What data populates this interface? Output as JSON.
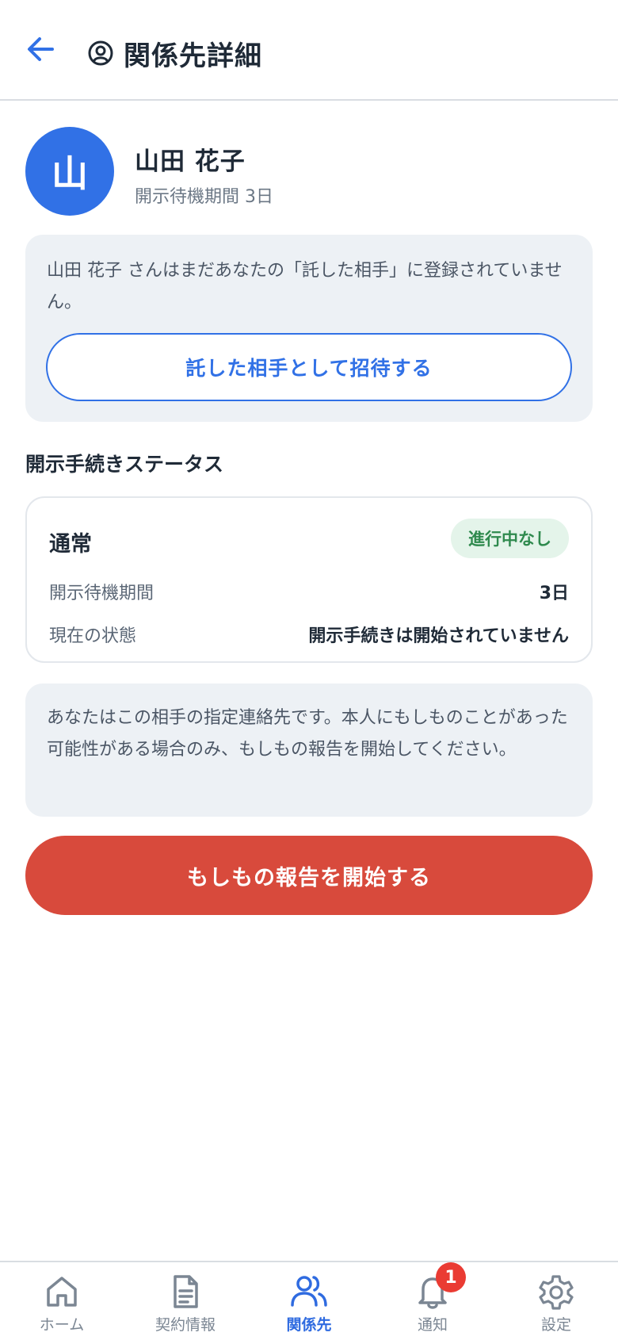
{
  "header": {
    "title": "関係先詳細"
  },
  "profile": {
    "avatar_initial": "山",
    "name": "山田 花子",
    "subtitle": "開示待機期間 3日"
  },
  "invite": {
    "message": "山田 花子 さんはまだあなたの「託した相手」に登録されていません。",
    "button_label": "託した相手として招待する"
  },
  "status_section": {
    "title": "開示手続きステータス",
    "card": {
      "name": "通常",
      "badge": "進行中なし",
      "rows": [
        {
          "label": "開示待機期間",
          "value": "3日"
        },
        {
          "label": "現在の状態",
          "value": "開示手続きは開始されていません"
        }
      ]
    }
  },
  "notice": {
    "message": "あなたはこの相手の指定連絡先です。本人にもしものことがあった可能性がある場合のみ、もしもの報告を開始してください。"
  },
  "report_button": {
    "label": "もしもの報告を開始する"
  },
  "tabbar": {
    "items": [
      {
        "label": "ホーム",
        "icon": "home-icon"
      },
      {
        "label": "契約情報",
        "icon": "document-icon"
      },
      {
        "label": "関係先",
        "icon": "users-icon",
        "active": true
      },
      {
        "label": "通知",
        "icon": "bell-icon",
        "badge": "1"
      },
      {
        "label": "設定",
        "icon": "gear-icon"
      }
    ]
  },
  "colors": {
    "accent": "#3171e6",
    "danger": "#d84a3c",
    "success": "#2f8a4e",
    "card_bg": "#edf1f5"
  }
}
